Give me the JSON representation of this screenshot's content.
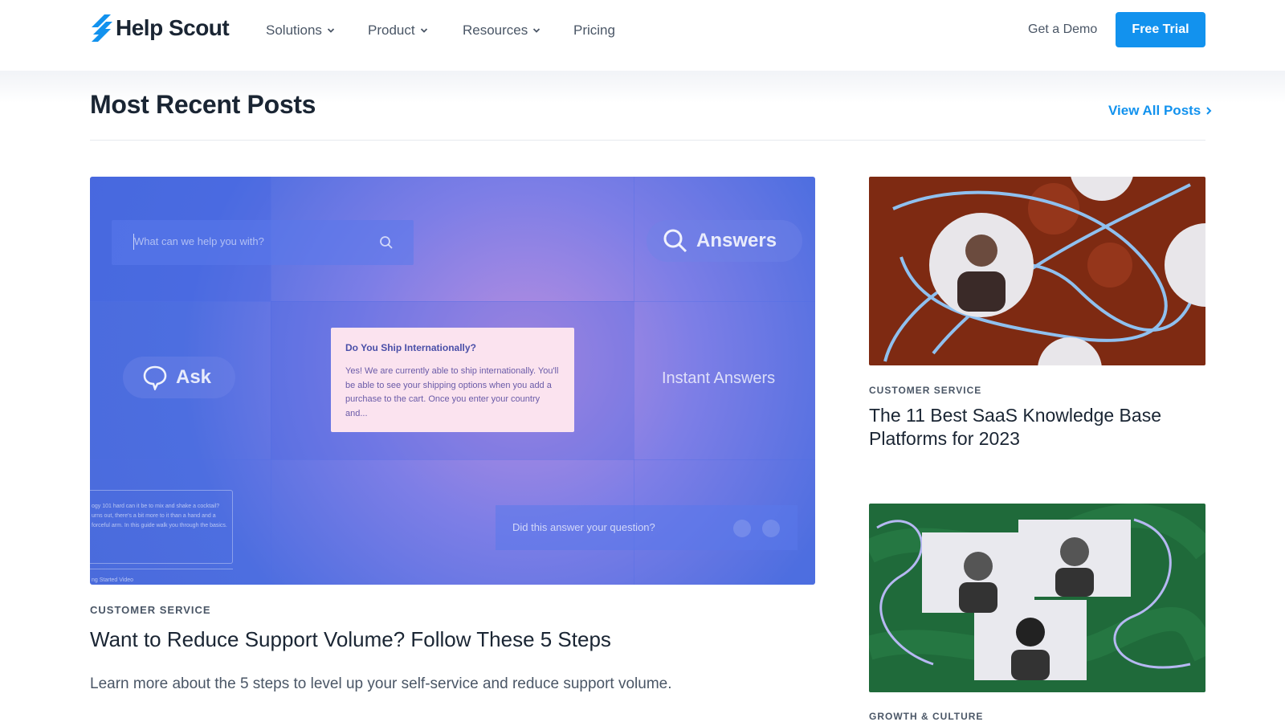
{
  "header": {
    "logo_text": "Help Scout",
    "nav": [
      {
        "label": "Solutions",
        "has_dropdown": true
      },
      {
        "label": "Product",
        "has_dropdown": true
      },
      {
        "label": "Resources",
        "has_dropdown": true
      },
      {
        "label": "Pricing",
        "has_dropdown": false
      }
    ],
    "get_demo": "Get a Demo",
    "free_trial": "Free Trial"
  },
  "section": {
    "title": "Most Recent Posts",
    "view_all": "View All Posts"
  },
  "featured_post": {
    "category": "CUSTOMER SERVICE",
    "title": "Want to Reduce Support Volume? Follow These 5 Steps",
    "description": "Learn more about the 5 steps to level up your self-service and reduce support volume.",
    "image": {
      "search_placeholder": "What can we help you with?",
      "answers_label": "Answers",
      "ask_label": "Ask",
      "instant_answers_label": "Instant Answers",
      "card_title": "Do You Ship Internationally?",
      "card_body": "Yes! We are currently able to ship internationally. You'll be able to see your shipping options when you add a purchase to the cart. Once you enter your country and...",
      "feedback_prompt": "Did this answer your question?",
      "doc_snippet": "ogy 101 hard can it be to mix and shake a cocktail? urns out, there's a bit more to it than a hand and a forceful arm. In this guide walk you through the basics.",
      "doc_link": "ng Started Video"
    }
  },
  "side_posts": [
    {
      "category": "CUSTOMER SERVICE",
      "title": "The 11 Best SaaS Knowledge Base Platforms for 2023"
    },
    {
      "category": "GROWTH & CULTURE",
      "title": ""
    }
  ],
  "colors": {
    "brand_blue": "#1292ee",
    "text_dark": "#1a2533",
    "text_muted": "#4a5666"
  }
}
